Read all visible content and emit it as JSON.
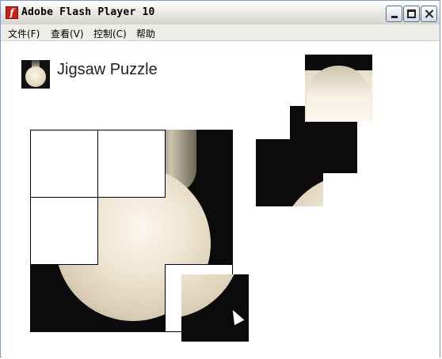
{
  "window": {
    "title": "Adobe Flash Player 10",
    "app_icon": "flash-player-icon",
    "controls": [
      "minimize-button",
      "maximize-button",
      "close-button"
    ]
  },
  "menubar": {
    "items": [
      {
        "label": "文件(F)"
      },
      {
        "label": "查看(V)"
      },
      {
        "label": "控制(C)"
      },
      {
        "label": "帮助"
      }
    ]
  },
  "game": {
    "title": "Jigsaw Puzzle",
    "grid": {
      "rows": 3,
      "cols": 3
    },
    "placed_pieces": 5,
    "empty_slots": 4,
    "loose_pieces": 4
  },
  "colors": {
    "title_bar": "#e8e6e4",
    "window_border": "#7a96df",
    "photo_background": "#0b0b0b",
    "bulb": "#efe6d3"
  }
}
